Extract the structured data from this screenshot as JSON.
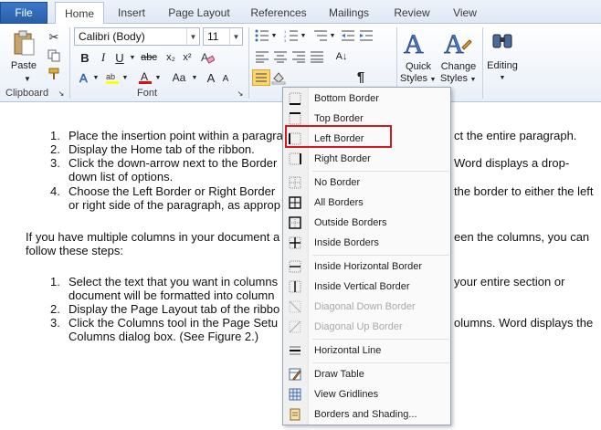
{
  "tabs": {
    "file": "File",
    "items": [
      "Home",
      "Insert",
      "Page Layout",
      "References",
      "Mailings",
      "Review",
      "View"
    ]
  },
  "ribbon": {
    "clipboard": {
      "paste": "Paste",
      "label": "Clipboard"
    },
    "font": {
      "name": "Calibri (Body)",
      "size": "11",
      "label": "Font",
      "grow": "A",
      "shrink": "A",
      "case": "Aa"
    },
    "paragraph": {
      "sort": "A↓",
      "pilcrow": "¶"
    },
    "styles": {
      "quick": "Quick",
      "quick2": "Styles",
      "change": "Change",
      "change2": "Styles"
    },
    "editing": {
      "label": "Editing"
    },
    "accent": "#2a5fa8"
  },
  "document": {
    "list1": [
      {
        "num": "1.",
        "text": "Place the insertion point within a paragra"
      },
      {
        "num": "2.",
        "text": "Display the Home tab of the ribbon."
      },
      {
        "num": "3.",
        "text": "Click the down-arrow next to the Border"
      },
      {
        "num": "",
        "text": "down list of options."
      },
      {
        "num": "4.",
        "text": "Choose the Left Border or Right Border"
      },
      {
        "num": "",
        "text": "or right side of the paragraph, as approp"
      }
    ],
    "list1_right": [
      "ct the entire paragraph.",
      "Word displays a drop-",
      "the border to either the left"
    ],
    "para1": "If you have multiple columns in your document a",
    "para1_right": "een the columns, you can",
    "para2": "follow these steps:",
    "list2": [
      {
        "num": "1.",
        "text": "Select the text that you want in columns"
      },
      {
        "num": "",
        "text": "document will be formatted into column"
      },
      {
        "num": "2.",
        "text": "Display the Page Layout tab of the ribbo"
      },
      {
        "num": "3.",
        "text": "Click the Columns tool in the Page Setu"
      },
      {
        "num": "",
        "text": "Columns dialog box. (See Figure 2.)"
      }
    ],
    "list2_right": [
      "your entire section or",
      "olumns. Word displays the"
    ]
  },
  "menu": {
    "items": [
      {
        "label": "Bottom Border",
        "icon": "bottom-border-icon",
        "disabled": false
      },
      {
        "label": "Top Border",
        "icon": "top-border-icon",
        "disabled": false
      },
      {
        "label": "Left Border",
        "icon": "left-border-icon",
        "disabled": false
      },
      {
        "label": "Right Border",
        "icon": "right-border-icon",
        "disabled": false
      },
      {
        "label": "No Border",
        "icon": "no-border-icon",
        "disabled": false
      },
      {
        "label": "All Borders",
        "icon": "all-borders-icon",
        "disabled": false
      },
      {
        "label": "Outside Borders",
        "icon": "outside-borders-icon",
        "disabled": false
      },
      {
        "label": "Inside Borders",
        "icon": "inside-borders-icon",
        "disabled": false
      },
      {
        "label": "Inside Horizontal Border",
        "icon": "inside-horizontal-border-icon",
        "disabled": false
      },
      {
        "label": "Inside Vertical Border",
        "icon": "inside-vertical-border-icon",
        "disabled": false
      },
      {
        "label": "Diagonal Down Border",
        "icon": "diagonal-down-border-icon",
        "disabled": true
      },
      {
        "label": "Diagonal Up Border",
        "icon": "diagonal-up-border-icon",
        "disabled": true
      },
      {
        "label": "Horizontal Line",
        "icon": "horizontal-line-icon",
        "disabled": false
      },
      {
        "label": "Draw Table",
        "icon": "draw-table-icon",
        "disabled": false
      },
      {
        "label": "View Gridlines",
        "icon": "view-gridlines-icon",
        "disabled": false
      },
      {
        "label": "Borders and Shading...",
        "icon": "borders-shading-icon",
        "disabled": false
      }
    ],
    "highlight_color": "#d4181f"
  }
}
